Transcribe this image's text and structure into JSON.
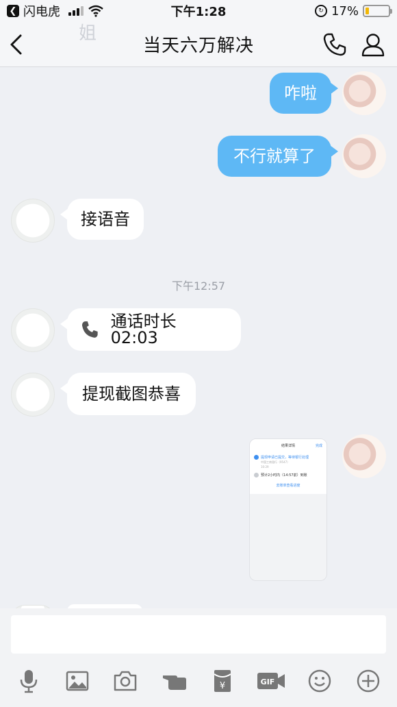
{
  "status_bar": {
    "back_app": "闪电虎",
    "time": "下午1:28",
    "battery": "17%",
    "battery_level": 0.17
  },
  "nav": {
    "title": "当天六万解决",
    "bg_text": "姐"
  },
  "messages": [
    {
      "side": "out",
      "text": "咋啦"
    },
    {
      "side": "out",
      "text": "不行就算了"
    },
    {
      "side": "in",
      "text": "接语音"
    },
    {
      "side": "in",
      "text": "通话时长 02:03",
      "type": "call"
    },
    {
      "side": "in",
      "text": "提现截图恭喜"
    }
  ],
  "timestamp": "下午12:57",
  "screenshot_card": {
    "title": "结果详情",
    "done": "完成",
    "step1": "提现申请已提交，等待银行处理",
    "step1_sub1": "中国工商银行（9547）",
    "step1_sub2": "10:29",
    "step2": "预计2小时内（14:57前）到账",
    "link": "去账单查看进度"
  },
  "colors": {
    "outgoing_bubble": "#5eb8f5",
    "incoming_bubble": "#ffffff",
    "background": "#eef0f4"
  },
  "toolbar_icons": [
    "mic-icon",
    "image-icon",
    "camera-icon",
    "poke-icon",
    "red-packet-icon",
    "gif-icon",
    "emoji-icon",
    "plus-icon"
  ]
}
